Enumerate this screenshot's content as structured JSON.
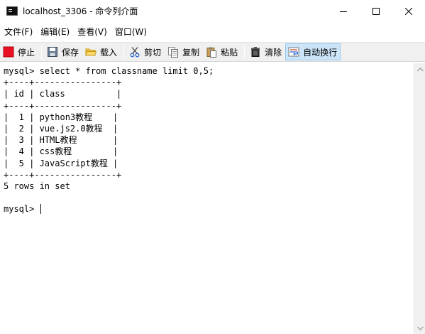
{
  "window": {
    "title": "localhost_3306 - 命令列介面",
    "icon": "terminal-icon",
    "controls": [
      "minimize-icon",
      "maximize-icon",
      "close-icon"
    ]
  },
  "menu": {
    "items": [
      {
        "label": "文件(F)"
      },
      {
        "label": "编辑(E)"
      },
      {
        "label": "查看(V)"
      },
      {
        "label": "窗口(W)"
      }
    ]
  },
  "toolbar": {
    "stop": {
      "label": "停止",
      "icon": "stop-icon",
      "color": "#e81123"
    },
    "save": {
      "label": "保存",
      "icon": "save-icon"
    },
    "load": {
      "label": "载入",
      "icon": "folder-open-icon"
    },
    "cut": {
      "label": "剪切",
      "icon": "scissors-icon"
    },
    "copy": {
      "label": "复制",
      "icon": "copy-icon"
    },
    "paste": {
      "label": "粘贴",
      "icon": "paste-icon"
    },
    "clear": {
      "label": "清除",
      "icon": "trash-icon"
    },
    "wrap": {
      "label": "自动换行",
      "icon": "wrap-icon",
      "active": true
    }
  },
  "console": {
    "lines": [
      "mysql> select * from classname limit 0,5;",
      "+----+----------------+",
      "| id | class          |",
      "+----+----------------+",
      "|  1 | python3教程    |",
      "|  2 | vue.js2.0教程  |",
      "|  3 | HTML教程       |",
      "|  4 | css教程        |",
      "|  5 | JavaScript教程 |",
      "+----+----------------+",
      "5 rows in set",
      "",
      "mysql> "
    ]
  }
}
